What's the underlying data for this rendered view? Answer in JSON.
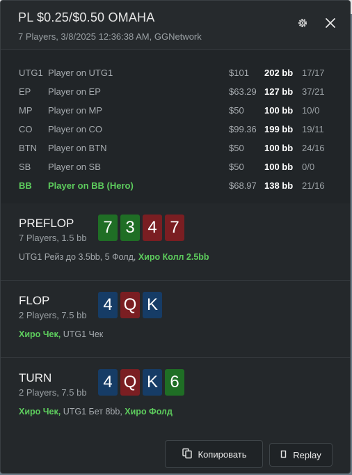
{
  "header": {
    "title": "PL $0.25/$0.50 OMAHA",
    "subtitle": "7 Players, 3/8/2025 12:36:38 AM, GGNetwork",
    "icons": [
      "gear-icon",
      "close-icon"
    ]
  },
  "players": [
    {
      "pos": "UTG1",
      "name": "Player on UTG1",
      "stack": "$101",
      "bb": "202 bb",
      "stat": "17/17",
      "hero": false
    },
    {
      "pos": "EP",
      "name": "Player on EP",
      "stack": "$63.29",
      "bb": "127 bb",
      "stat": "37/21",
      "hero": false
    },
    {
      "pos": "MP",
      "name": "Player on MP",
      "stack": "$50",
      "bb": "100 bb",
      "stat": "10/0",
      "hero": false
    },
    {
      "pos": "CO",
      "name": "Player on CO",
      "stack": "$99.36",
      "bb": "199 bb",
      "stat": "19/11",
      "hero": false
    },
    {
      "pos": "BTN",
      "name": "Player on BTN",
      "stack": "$50",
      "bb": "100 bb",
      "stat": "24/16",
      "hero": false
    },
    {
      "pos": "SB",
      "name": "Player on SB",
      "stack": "$50",
      "bb": "100 bb",
      "stat": "0/0",
      "hero": false
    },
    {
      "pos": "BB",
      "name": "Player on BB (Hero)",
      "stack": "$68.97",
      "bb": "138 bb",
      "stat": "21/16",
      "hero": true
    }
  ],
  "streets": {
    "preflop": {
      "name": "PREFLOP",
      "info": "7 Players, 1.5 bb",
      "cards": [
        {
          "rank": "7",
          "color": "#1f6e25"
        },
        {
          "rank": "3",
          "color": "#1f6e25"
        },
        {
          "rank": "4",
          "color": "#7a1e22"
        },
        {
          "rank": "7",
          "color": "#7a1e22"
        }
      ],
      "actions": {
        "a1": "UTG1 Рейз до 3.5bb, 5 Фолд,",
        "a2": "Хиро Колл 2.5bb"
      }
    },
    "flop": {
      "name": "FLOP",
      "info": "2 Players, 7.5 bb",
      "cards": [
        {
          "rank": "4",
          "color": "#163c66"
        },
        {
          "rank": "Q",
          "color": "#7a1e22"
        },
        {
          "rank": "K",
          "color": "#163c66"
        }
      ],
      "actions": {
        "a1": "Хиро Чек,",
        "a2": "UTG1 Чек"
      }
    },
    "turn": {
      "name": "TURN",
      "info": "2 Players, 7.5 bb",
      "cards": [
        {
          "rank": "4",
          "color": "#163c66"
        },
        {
          "rank": "Q",
          "color": "#7a1e22"
        },
        {
          "rank": "K",
          "color": "#163c66"
        },
        {
          "rank": "6",
          "color": "#1f6e25"
        }
      ],
      "actions": {
        "a1": "Хиро Чек,",
        "a2": "UTG1 Бет 8bb,",
        "a3": "Хиро Фолд"
      }
    }
  },
  "buttons": {
    "copy_label": "Копировать",
    "copy_icon": "copy-icon",
    "replay_label": "Replay",
    "replay_icon": "replay-icon"
  },
  "colors": {
    "hero_green": "#5dcc5d",
    "panel_bg": "#24282b"
  }
}
